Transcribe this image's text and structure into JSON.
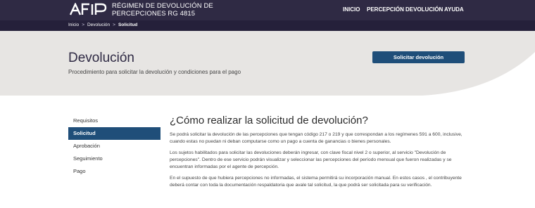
{
  "header": {
    "logo_text": "AFIP",
    "title_line1": "RÉGIMEN DE DEVOLUCIÓN DE",
    "title_line2": "PERCEPCIONES RG 4815",
    "nav": [
      {
        "label": "INICIO"
      },
      {
        "label": "PERCEPCIÓN"
      },
      {
        "label": "DEVOLUCIÓN"
      },
      {
        "label": "AYUDA"
      }
    ]
  },
  "breadcrumb": {
    "items": [
      "Inicio",
      "Devolución",
      "Solicitud"
    ],
    "separator": ">"
  },
  "hero": {
    "title": "Devolución",
    "subtitle": "Procedimiento para solicitar la devolución y condiciones para el pago",
    "button_label": "Solicitar devolución"
  },
  "sidebar": {
    "items": [
      {
        "label": "Requisitos",
        "active": false
      },
      {
        "label": "Solicitud",
        "active": true
      },
      {
        "label": "Aprobación",
        "active": false
      },
      {
        "label": "Seguimiento",
        "active": false
      },
      {
        "label": "Pago",
        "active": false
      }
    ]
  },
  "main": {
    "heading": "¿Cómo realizar la solicitud de devolución?",
    "paragraphs": [
      "Se podrá solicitar la devolución de las percepciones que tengan código 217 o 219 y que correspondan a los regímenes 591 a 600, inclusive, cuando estas no puedan ni deban computarse como un pago a cuenta de ganancias o bienes personales.",
      "Los sujetos habilitados para solicitar las devoluciones deberán ingresar, con clave fiscal nivel 2 o superior, al servicio \"Devolución de percepciones\". Dentro de ese servicio podrán visualizar y seleccionar las percepciones del período mensual que fueron realizadas y se encuentran informadas por el agente de percepción.",
      "En el supuesto de que hubiera percepciones no informadas, el sistema permitirá su incorporación manual. En estos casos , el contribuyente deberá contar con toda la documentación respaldatoria que avale tal solicitud, la que podrá ser solicitada para su verificación."
    ]
  },
  "colors": {
    "header_bg": "#2f2a44",
    "breadcrumb_bg": "#25203a",
    "hero_bg": "#e7e5e3",
    "accent": "#1f4e79"
  }
}
